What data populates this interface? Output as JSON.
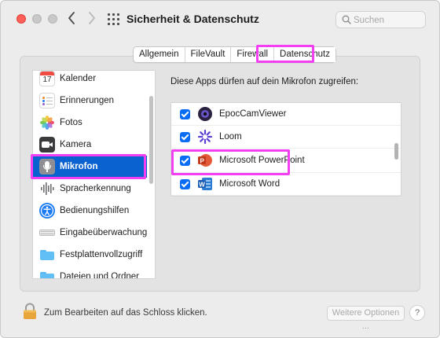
{
  "window": {
    "title": "Sicherheit & Datenschutz",
    "search_placeholder": "Suchen"
  },
  "tabs": [
    {
      "label": "Allgemein",
      "active": false
    },
    {
      "label": "FileVault",
      "active": false
    },
    {
      "label": "Firewall",
      "active": false
    },
    {
      "label": "Datenschutz",
      "active": true
    }
  ],
  "sidebar": {
    "items": [
      {
        "label": "Kalender",
        "icon": "calendar-icon",
        "selected": false
      },
      {
        "label": "Erinnerungen",
        "icon": "reminders-icon",
        "selected": false
      },
      {
        "label": "Fotos",
        "icon": "photos-icon",
        "selected": false
      },
      {
        "label": "Kamera",
        "icon": "camera-icon",
        "selected": false
      },
      {
        "label": "Mikrofon",
        "icon": "microphone-icon",
        "selected": true
      },
      {
        "label": "Spracherkennung",
        "icon": "speech-recognition-icon",
        "selected": false
      },
      {
        "label": "Bedienungshilfen",
        "icon": "accessibility-icon",
        "selected": false
      },
      {
        "label": "Eingabeüberwachung",
        "icon": "keyboard-icon",
        "selected": false
      },
      {
        "label": "Festplattenvollzugriff",
        "icon": "folder-icon",
        "selected": false
      },
      {
        "label": "Dateien und Ordner",
        "icon": "folder-icon",
        "selected": false
      }
    ]
  },
  "main": {
    "description": "Diese Apps dürfen auf dein Mikrofon zugreifen:",
    "apps": [
      {
        "label": "EpocCamViewer",
        "icon": "epoccam-icon",
        "checked": true
      },
      {
        "label": "Loom",
        "icon": "loom-icon",
        "checked": true
      },
      {
        "label": "Microsoft PowerPoint",
        "icon": "powerpoint-icon",
        "checked": true
      },
      {
        "label": "Microsoft Word",
        "icon": "word-icon",
        "checked": true
      }
    ]
  },
  "footer": {
    "lock_text": "Zum Bearbeiten auf das Schloss klicken.",
    "more_options": "Weitere Optionen ...",
    "help": "?"
  },
  "colors": {
    "accent": "#0a62d0",
    "highlight": "#f23ff2",
    "checkbox": "#0a6cf5"
  }
}
